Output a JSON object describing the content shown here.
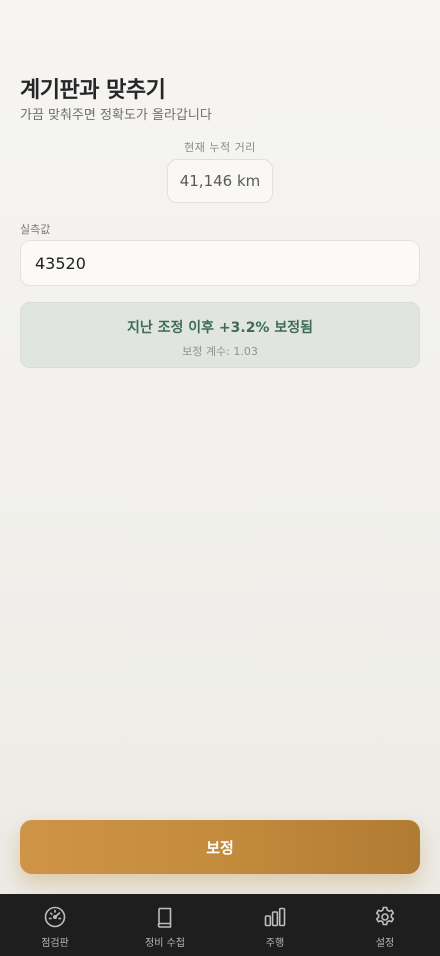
{
  "header": {
    "title": "계기판과 맞추기",
    "subtitle": "가끔 맞춰주면 정확도가 올라갑니다"
  },
  "current": {
    "label": "현재 누적 거리",
    "value": "41,146 km"
  },
  "actual": {
    "label": "실측값",
    "value": "43520"
  },
  "result": {
    "message": "지난 조정 이후 +3.2% 보정됨",
    "coefficient": "보정 계수: 1.03"
  },
  "action": {
    "label": "보정"
  },
  "colors": {
    "accent": "#c48b3d",
    "success_text": "#3f6b5c",
    "tabbar": "#1e1e1e"
  },
  "tabs": [
    {
      "label": "점검판",
      "icon": "gauge-icon"
    },
    {
      "label": "정비 수첩",
      "icon": "book-icon"
    },
    {
      "label": "주행",
      "icon": "bar-chart-icon"
    },
    {
      "label": "설정",
      "icon": "gear-icon"
    }
  ]
}
